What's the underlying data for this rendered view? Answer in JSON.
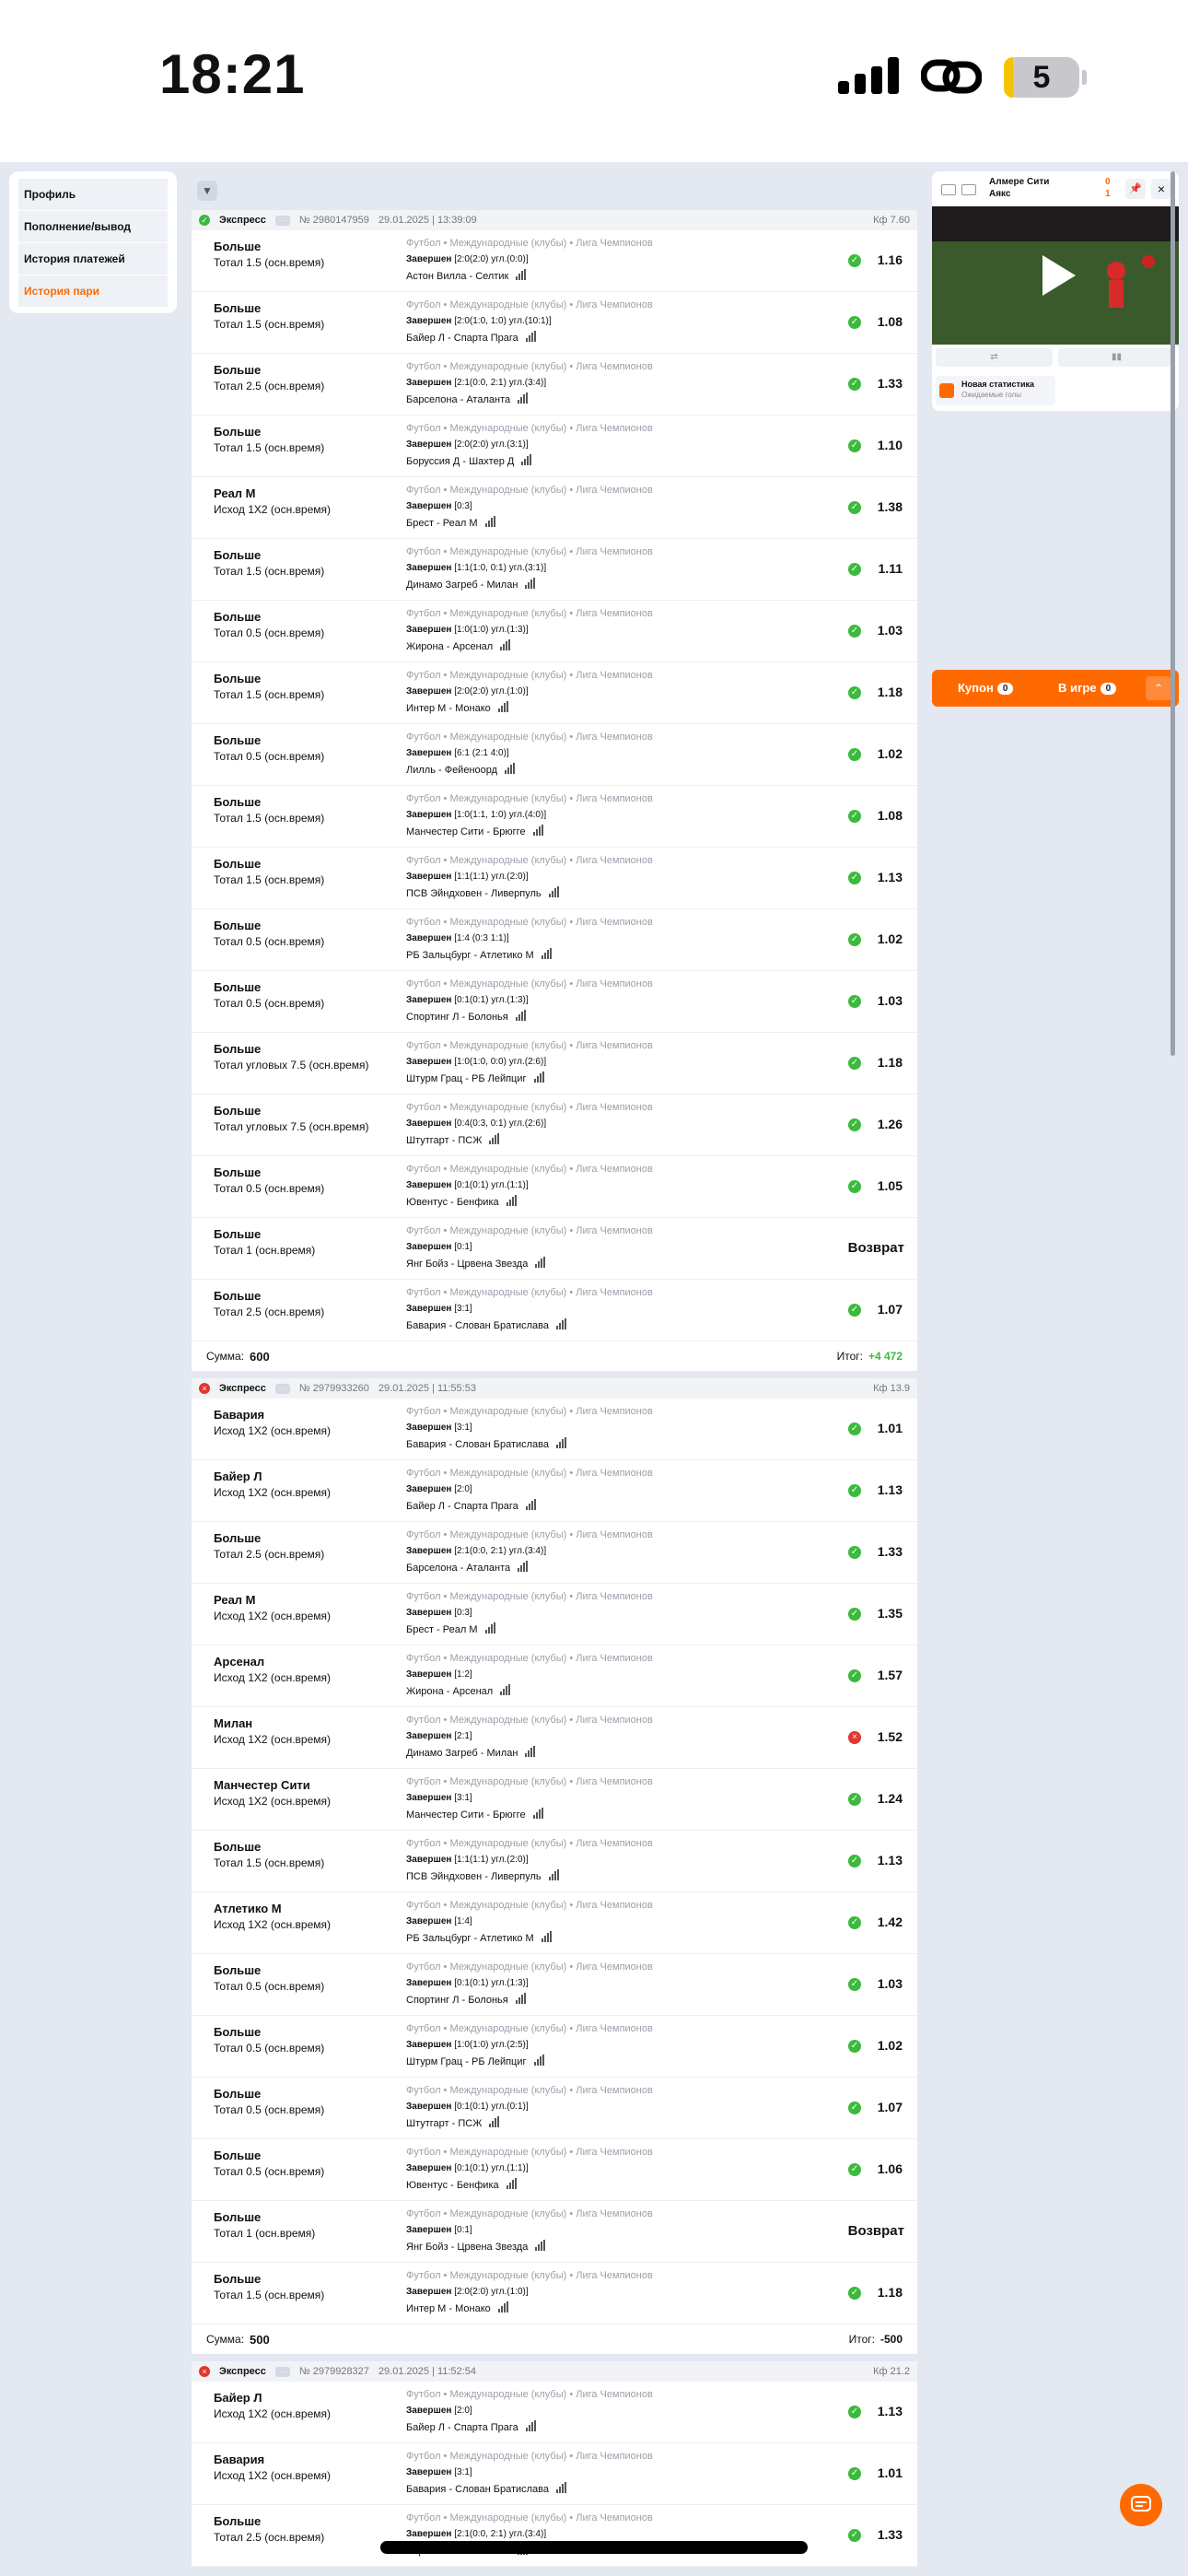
{
  "status_bar": {
    "time": "18:21",
    "battery": "5"
  },
  "sidebar": {
    "items": [
      {
        "label": "Профиль",
        "active": false
      },
      {
        "label": "Пополнение/вывод",
        "active": false
      },
      {
        "label": "История платежей",
        "active": false
      },
      {
        "label": "История пари",
        "active": true
      }
    ]
  },
  "filter_icon": "filter-icon",
  "bets": [
    {
      "status": "win",
      "type": "Экспресс",
      "number": "№ 2980147959",
      "date": "29.01.2025 | 13:39:09",
      "kf": "Кф 7.60",
      "events": [
        {
          "pick": "Больше",
          "market": "Тотал 1.5 (осн.время)",
          "category": "Футбол  •  Международные (клубы)  •  Лига Чемпионов",
          "result_status": "Завершен",
          "result_score": "[2:0(2:0) угл.(0:0)]",
          "teams": "Астон Вилла - Селтик",
          "outcome": "win",
          "coef": "1.16"
        },
        {
          "pick": "Больше",
          "market": "Тотал 1.5 (осн.время)",
          "category": "Футбол  •  Международные (клубы)  •  Лига Чемпионов",
          "result_status": "Завершен",
          "result_score": "[2:0(1:0, 1:0) угл.(10:1)]",
          "teams": "Байер Л - Спарта Прага",
          "outcome": "win",
          "coef": "1.08"
        },
        {
          "pick": "Больше",
          "market": "Тотал 2.5 (осн.время)",
          "category": "Футбол  •  Международные (клубы)  •  Лига Чемпионов",
          "result_status": "Завершен",
          "result_score": "[2:1(0:0, 2:1) угл.(3:4)]",
          "teams": "Барселона - Аталанта",
          "outcome": "win",
          "coef": "1.33"
        },
        {
          "pick": "Больше",
          "market": "Тотал 1.5 (осн.время)",
          "category": "Футбол  •  Международные (клубы)  •  Лига Чемпионов",
          "result_status": "Завершен",
          "result_score": "[2:0(2:0) угл.(3:1)]",
          "teams": "Боруссия Д - Шахтер Д",
          "outcome": "win",
          "coef": "1.10"
        },
        {
          "pick": "Реал М",
          "market": "Исход 1X2 (осн.время)",
          "category": "Футбол  •  Международные (клубы)  •  Лига Чемпионов",
          "result_status": "Завершен",
          "result_score": "[0:3]",
          "teams": "Брест - Реал М",
          "outcome": "win",
          "coef": "1.38"
        },
        {
          "pick": "Больше",
          "market": "Тотал 1.5 (осн.время)",
          "category": "Футбол  •  Международные (клубы)  •  Лига Чемпионов",
          "result_status": "Завершен",
          "result_score": "[1:1(1:0, 0:1) угл.(3:1)]",
          "teams": "Динамо Загреб - Милан",
          "outcome": "win",
          "coef": "1.11"
        },
        {
          "pick": "Больше",
          "market": "Тотал 0.5 (осн.время)",
          "category": "Футбол  •  Международные (клубы)  •  Лига Чемпионов",
          "result_status": "Завершен",
          "result_score": "[1:0(1:0) угл.(1:3)]",
          "teams": "Жирона - Арсенал",
          "outcome": "win",
          "coef": "1.03"
        },
        {
          "pick": "Больше",
          "market": "Тотал 1.5 (осн.время)",
          "category": "Футбол  •  Международные (клубы)  •  Лига Чемпионов",
          "result_status": "Завершен",
          "result_score": "[2:0(2:0) угл.(1:0)]",
          "teams": "Интер М - Монако",
          "outcome": "win",
          "coef": "1.18"
        },
        {
          "pick": "Больше",
          "market": "Тотал 0.5 (осн.время)",
          "category": "Футбол  •  Международные (клубы)  •  Лига Чемпионов",
          "result_status": "Завершен",
          "result_score": "[6:1 (2:1 4:0)]",
          "teams": "Лилль - Фейеноорд",
          "outcome": "win",
          "coef": "1.02"
        },
        {
          "pick": "Больше",
          "market": "Тотал 1.5 (осн.время)",
          "category": "Футбол  •  Международные (клубы)  •  Лига Чемпионов",
          "result_status": "Завершен",
          "result_score": "[1:0(1:1, 1:0) угл.(4:0)]",
          "teams": "Манчестер Сити - Брюгге",
          "outcome": "win",
          "coef": "1.08"
        },
        {
          "pick": "Больше",
          "market": "Тотал 1.5 (осн.время)",
          "category": "Футбол  •  Международные (клубы)  •  Лига Чемпионов",
          "result_status": "Завершен",
          "result_score": "[1:1(1:1) угл.(2:0)]",
          "teams": "ПСВ Эйндховен - Ливерпуль",
          "outcome": "win",
          "coef": "1.13"
        },
        {
          "pick": "Больше",
          "market": "Тотал 0.5 (осн.время)",
          "category": "Футбол  •  Международные (клубы)  •  Лига Чемпионов",
          "result_status": "Завершен",
          "result_score": "[1:4 (0:3 1:1)]",
          "teams": "РБ Зальцбург - Атлетико М",
          "outcome": "win",
          "coef": "1.02"
        },
        {
          "pick": "Больше",
          "market": "Тотал 0.5 (осн.время)",
          "category": "Футбол  •  Международные (клубы)  •  Лига Чемпионов",
          "result_status": "Завершен",
          "result_score": "[0:1(0:1) угл.(1:3)]",
          "teams": "Спортинг Л - Болонья",
          "outcome": "win",
          "coef": "1.03"
        },
        {
          "pick": "Больше",
          "market": "Тотал угловых 7.5 (осн.время)",
          "category": "Футбол  •  Международные (клубы)  •  Лига Чемпионов",
          "result_status": "Завершен",
          "result_score": "[1:0(1:0, 0:0) угл.(2:6)]",
          "teams": "Штурм Грац - РБ Лейпциг",
          "outcome": "win",
          "coef": "1.18"
        },
        {
          "pick": "Больше",
          "market": "Тотал угловых 7.5 (осн.время)",
          "category": "Футбол  •  Международные (клубы)  •  Лига Чемпионов",
          "result_status": "Завершен",
          "result_score": "[0:4(0:3, 0:1) угл.(2:6)]",
          "teams": "Штутгарт - ПСЖ",
          "outcome": "win",
          "coef": "1.26"
        },
        {
          "pick": "Больше",
          "market": "Тотал 0.5 (осн.время)",
          "category": "Футбол  •  Международные (клубы)  •  Лига Чемпионов",
          "result_status": "Завершен",
          "result_score": "[0:1(0:1) угл.(1:1)]",
          "teams": "Ювентус - Бенфика",
          "outcome": "win",
          "coef": "1.05"
        },
        {
          "pick": "Больше",
          "market": "Тотал 1 (осн.время)",
          "category": "Футбол  •  Международные (клубы)  •  Лига Чемпионов",
          "result_status": "Завершен",
          "result_score": "[0:1]",
          "teams": "Янг Бойз - Црвена Звезда",
          "outcome": "return",
          "coef": "Возврат"
        },
        {
          "pick": "Больше",
          "market": "Тотал 2.5 (осн.время)",
          "category": "Футбол  •  Международные (клубы)  •  Лига Чемпионов",
          "result_status": "Завершен",
          "result_score": "[3:1]",
          "teams": "Бавария - Слован Братислава",
          "outcome": "win",
          "coef": "1.07"
        }
      ],
      "sum_label": "Сумма:",
      "sum": "600",
      "itog_label": "Итог:",
      "itog": "+4 472",
      "itog_positive": true
    },
    {
      "status": "lose",
      "type": "Экспресс",
      "number": "№ 2979933260",
      "date": "29.01.2025 | 11:55:53",
      "kf": "Кф 13.9",
      "events": [
        {
          "pick": "Бавария",
          "market": "Исход 1X2 (осн.время)",
          "category": "Футбол  •  Международные (клубы)  •  Лига Чемпионов",
          "result_status": "Завершен",
          "result_score": "[3:1]",
          "teams": "Бавария - Слован Братислава",
          "outcome": "win",
          "coef": "1.01"
        },
        {
          "pick": "Байер Л",
          "market": "Исход 1X2 (осн.время)",
          "category": "Футбол  •  Международные (клубы)  •  Лига Чемпионов",
          "result_status": "Завершен",
          "result_score": "[2:0]",
          "teams": "Байер Л - Спарта Прага",
          "outcome": "win",
          "coef": "1.13"
        },
        {
          "pick": "Больше",
          "market": "Тотал 2.5 (осн.время)",
          "category": "Футбол  •  Международные (клубы)  •  Лига Чемпионов",
          "result_status": "Завершен",
          "result_score": "[2:1(0:0, 2:1) угл.(3:4)]",
          "teams": "Барселона - Аталанта",
          "outcome": "win",
          "coef": "1.33"
        },
        {
          "pick": "Реал М",
          "market": "Исход 1X2 (осн.время)",
          "category": "Футбол  •  Международные (клубы)  •  Лига Чемпионов",
          "result_status": "Завершен",
          "result_score": "[0:3]",
          "teams": "Брест - Реал М",
          "outcome": "win",
          "coef": "1.35"
        },
        {
          "pick": "Арсенал",
          "market": "Исход 1X2 (осн.время)",
          "category": "Футбол  •  Международные (клубы)  •  Лига Чемпионов",
          "result_status": "Завершен",
          "result_score": "[1:2]",
          "teams": "Жирона - Арсенал",
          "outcome": "win",
          "coef": "1.57"
        },
        {
          "pick": "Милан",
          "market": "Исход 1X2 (осн.время)",
          "category": "Футбол  •  Международные (клубы)  •  Лига Чемпионов",
          "result_status": "Завершен",
          "result_score": "[2:1]",
          "teams": "Динамо Загреб - Милан",
          "outcome": "lose",
          "coef": "1.52"
        },
        {
          "pick": "Манчестер Сити",
          "market": "Исход 1X2 (осн.время)",
          "category": "Футбол  •  Международные (клубы)  •  Лига Чемпионов",
          "result_status": "Завершен",
          "result_score": "[3:1]",
          "teams": "Манчестер Сити - Брюгге",
          "outcome": "win",
          "coef": "1.24"
        },
        {
          "pick": "Больше",
          "market": "Тотал 1.5 (осн.время)",
          "category": "Футбол  •  Международные (клубы)  •  Лига Чемпионов",
          "result_status": "Завершен",
          "result_score": "[1:1(1:1) угл.(2:0)]",
          "teams": "ПСВ Эйндховен - Ливерпуль",
          "outcome": "win",
          "coef": "1.13"
        },
        {
          "pick": "Атлетико М",
          "market": "Исход 1X2 (осн.время)",
          "category": "Футбол  •  Международные (клубы)  •  Лига Чемпионов",
          "result_status": "Завершен",
          "result_score": "[1:4]",
          "teams": "РБ Зальцбург - Атлетико М",
          "outcome": "win",
          "coef": "1.42"
        },
        {
          "pick": "Больше",
          "market": "Тотал 0.5 (осн.время)",
          "category": "Футбол  •  Международные (клубы)  •  Лига Чемпионов",
          "result_status": "Завершен",
          "result_score": "[0:1(0:1) угл.(1:3)]",
          "teams": "Спортинг Л - Болонья",
          "outcome": "win",
          "coef": "1.03"
        },
        {
          "pick": "Больше",
          "market": "Тотал 0.5 (осн.время)",
          "category": "Футбол  •  Международные (клубы)  •  Лига Чемпионов",
          "result_status": "Завершен",
          "result_score": "[1:0(1:0) угл.(2:5)]",
          "teams": "Штурм Грац - РБ Лейпциг",
          "outcome": "win",
          "coef": "1.02"
        },
        {
          "pick": "Больше",
          "market": "Тотал 0.5 (осн.время)",
          "category": "Футбол  •  Международные (клубы)  •  Лига Чемпионов",
          "result_status": "Завершен",
          "result_score": "[0:1(0:1) угл.(0:1)]",
          "teams": "Штутгарт - ПСЖ",
          "outcome": "win",
          "coef": "1.07"
        },
        {
          "pick": "Больше",
          "market": "Тотал 0.5 (осн.время)",
          "category": "Футбол  •  Международные (клубы)  •  Лига Чемпионов",
          "result_status": "Завершен",
          "result_score": "[0:1(0:1) угл.(1:1)]",
          "teams": "Ювентус - Бенфика",
          "outcome": "win",
          "coef": "1.06"
        },
        {
          "pick": "Больше",
          "market": "Тотал 1 (осн.время)",
          "category": "Футбол  •  Международные (клубы)  •  Лига Чемпионов",
          "result_status": "Завершен",
          "result_score": "[0:1]",
          "teams": "Янг Бойз - Црвена Звезда",
          "outcome": "return",
          "coef": "Возврат"
        },
        {
          "pick": "Больше",
          "market": "Тотал 1.5 (осн.время)",
          "category": "Футбол  •  Международные (клубы)  •  Лига Чемпионов",
          "result_status": "Завершен",
          "result_score": "[2:0(2:0) угл.(1:0)]",
          "teams": "Интер М - Монако",
          "outcome": "win",
          "coef": "1.18"
        }
      ],
      "sum_label": "Сумма:",
      "sum": "500",
      "itog_label": "Итог:",
      "itog": "-500",
      "itog_positive": false
    },
    {
      "status": "lose",
      "type": "Экспресс",
      "number": "№ 2979928327",
      "date": "29.01.2025 | 11:52:54",
      "kf": "Кф 21.2",
      "events": [
        {
          "pick": "Байер Л",
          "market": "Исход 1X2 (осн.время)",
          "category": "Футбол  •  Международные (клубы)  •  Лига Чемпионов",
          "result_status": "Завершен",
          "result_score": "[2:0]",
          "teams": "Байер Л - Спарта Прага",
          "outcome": "win",
          "coef": "1.13"
        },
        {
          "pick": "Бавария",
          "market": "Исход 1X2 (осн.время)",
          "category": "Футбол  •  Международные (клубы)  •  Лига Чемпионов",
          "result_status": "Завершен",
          "result_score": "[3:1]",
          "teams": "Бавария - Слован Братислава",
          "outcome": "win",
          "coef": "1.01"
        },
        {
          "pick": "Больше",
          "market": "Тотал 2.5 (осн.время)",
          "category": "Футбол  •  Международные (клубы)  •  Лига Чемпионов",
          "result_status": "Завершен",
          "result_score": "[2:1(0:0, 2:1) угл.(3:4)]",
          "teams": "Барселона - Аталанта",
          "outcome": "win",
          "coef": "1.33"
        }
      ],
      "sum_label": "",
      "sum": "",
      "itog_label": "",
      "itog": "",
      "itog_positive": false
    }
  ],
  "widget": {
    "team1": "Алмере Сити",
    "team2": "Аякс",
    "score1": "0",
    "score2": "1",
    "new_stat_title": "Новая статистика",
    "new_stat_sub": "Ожидаемые голы"
  },
  "coupon": {
    "coupon_label": "Купон",
    "coupon_count": "0",
    "ingame_label": "В игре",
    "ingame_count": "0"
  },
  "colors": {
    "accent": "#ff6a00",
    "win": "#3cba3c",
    "lose": "#e3362f",
    "background": "#e3e8f1"
  }
}
